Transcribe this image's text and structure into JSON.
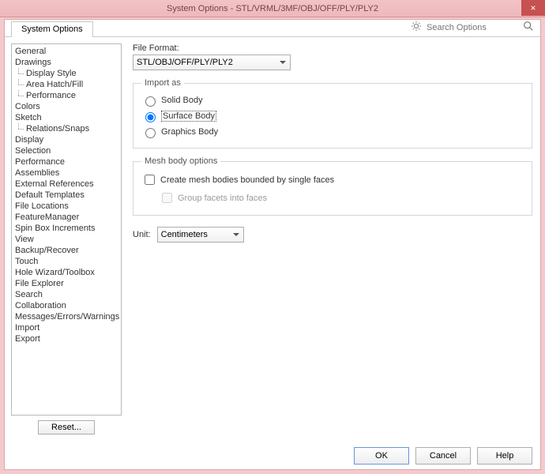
{
  "window": {
    "title": "System Options - STL/VRML/3MF/OBJ/OFF/PLY/PLY2"
  },
  "tab": {
    "label": "System Options"
  },
  "search": {
    "placeholder": "Search Options"
  },
  "sidebar": {
    "items": [
      {
        "label": "General",
        "child": false
      },
      {
        "label": "Drawings",
        "child": false
      },
      {
        "label": "Display Style",
        "child": true
      },
      {
        "label": "Area Hatch/Fill",
        "child": true
      },
      {
        "label": "Performance",
        "child": true
      },
      {
        "label": "Colors",
        "child": false
      },
      {
        "label": "Sketch",
        "child": false
      },
      {
        "label": "Relations/Snaps",
        "child": true
      },
      {
        "label": "Display",
        "child": false
      },
      {
        "label": "Selection",
        "child": false
      },
      {
        "label": "Performance",
        "child": false
      },
      {
        "label": "Assemblies",
        "child": false
      },
      {
        "label": "External References",
        "child": false
      },
      {
        "label": "Default Templates",
        "child": false
      },
      {
        "label": "File Locations",
        "child": false
      },
      {
        "label": "FeatureManager",
        "child": false
      },
      {
        "label": "Spin Box Increments",
        "child": false
      },
      {
        "label": "View",
        "child": false
      },
      {
        "label": "Backup/Recover",
        "child": false
      },
      {
        "label": "Touch",
        "child": false
      },
      {
        "label": "Hole Wizard/Toolbox",
        "child": false
      },
      {
        "label": "File Explorer",
        "child": false
      },
      {
        "label": "Search",
        "child": false
      },
      {
        "label": "Collaboration",
        "child": false
      },
      {
        "label": "Messages/Errors/Warnings",
        "child": false
      },
      {
        "label": "Import",
        "child": false
      },
      {
        "label": "Export",
        "child": false
      }
    ],
    "reset_label": "Reset..."
  },
  "main": {
    "file_format_label": "File Format:",
    "file_format_value": "STL/OBJ/OFF/PLY/PLY2",
    "import_as": {
      "legend": "Import as",
      "solid": "Solid Body",
      "surface": "Surface Body",
      "graphics": "Graphics Body",
      "selected": "surface"
    },
    "mesh": {
      "legend": "Mesh body options",
      "bounded": "Create mesh bodies bounded by single faces",
      "group": "Group facets into faces"
    },
    "unit": {
      "label": "Unit:",
      "value": "Centimeters"
    }
  },
  "footer": {
    "ok": "OK",
    "cancel": "Cancel",
    "help": "Help"
  }
}
